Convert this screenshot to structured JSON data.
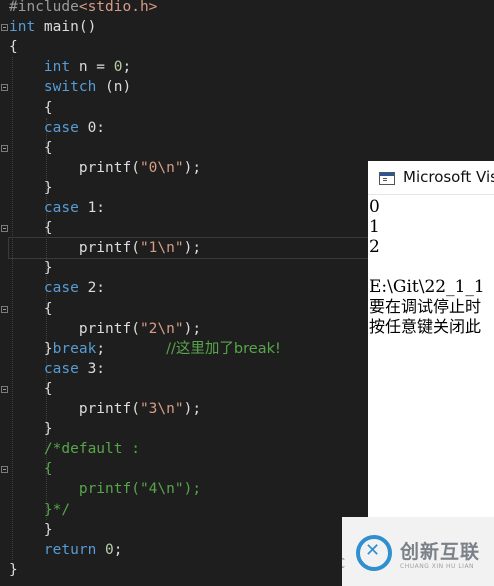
{
  "editor": {
    "lines": [
      {
        "segs": [
          {
            "t": "#include",
            "c": "pp"
          },
          {
            "t": "<stdio.h>",
            "c": "inc"
          }
        ]
      },
      {
        "segs": [
          {
            "t": "int",
            "c": "kw"
          },
          {
            "t": " main()",
            "c": "pl"
          }
        ]
      },
      {
        "segs": [
          {
            "t": "{",
            "c": "pl"
          }
        ]
      },
      {
        "segs": [
          {
            "t": "    int",
            "c": "kw"
          },
          {
            "t": " n = ",
            "c": "pl"
          },
          {
            "t": "0",
            "c": "num"
          },
          {
            "t": ";",
            "c": "pl"
          }
        ]
      },
      {
        "segs": [
          {
            "t": "    switch",
            "c": "kw"
          },
          {
            "t": " (n)",
            "c": "pl"
          }
        ]
      },
      {
        "segs": [
          {
            "t": "    {",
            "c": "pl"
          }
        ]
      },
      {
        "segs": [
          {
            "t": "    case",
            "c": "kw"
          },
          {
            "t": " 0:",
            "c": "pl"
          }
        ]
      },
      {
        "segs": [
          {
            "t": "    {",
            "c": "pl"
          }
        ]
      },
      {
        "segs": [
          {
            "t": "        printf(",
            "c": "fn"
          },
          {
            "t": "\"0\\n\"",
            "c": "str"
          },
          {
            "t": ");",
            "c": "pl"
          }
        ]
      },
      {
        "segs": [
          {
            "t": "    }",
            "c": "pl"
          }
        ]
      },
      {
        "segs": [
          {
            "t": "    case",
            "c": "kw"
          },
          {
            "t": " 1:",
            "c": "pl"
          }
        ]
      },
      {
        "segs": [
          {
            "t": "    {",
            "c": "pl"
          }
        ]
      },
      {
        "segs": [
          {
            "t": "        printf(",
            "c": "fn"
          },
          {
            "t": "\"1\\n\"",
            "c": "str"
          },
          {
            "t": ");",
            "c": "pl"
          }
        ]
      },
      {
        "segs": [
          {
            "t": "    }",
            "c": "pl"
          }
        ]
      },
      {
        "segs": [
          {
            "t": "    case",
            "c": "kw"
          },
          {
            "t": " 2:",
            "c": "pl"
          }
        ]
      },
      {
        "segs": [
          {
            "t": "    {",
            "c": "pl"
          }
        ]
      },
      {
        "segs": [
          {
            "t": "        printf(",
            "c": "fn"
          },
          {
            "t": "\"2\\n\"",
            "c": "str"
          },
          {
            "t": ");",
            "c": "pl"
          }
        ]
      },
      {
        "segs": [
          {
            "t": "    }",
            "c": "pl"
          },
          {
            "t": "break",
            "c": "kw"
          },
          {
            "t": ";       ",
            "c": "pl"
          },
          {
            "t": "//这里加了break!",
            "c": "cmt"
          }
        ]
      },
      {
        "segs": [
          {
            "t": "    case",
            "c": "kw"
          },
          {
            "t": " 3:",
            "c": "pl"
          }
        ]
      },
      {
        "segs": [
          {
            "t": "    {",
            "c": "pl"
          }
        ]
      },
      {
        "segs": [
          {
            "t": "        printf(",
            "c": "fn"
          },
          {
            "t": "\"3\\n\"",
            "c": "str"
          },
          {
            "t": ");",
            "c": "pl"
          }
        ]
      },
      {
        "segs": [
          {
            "t": "    }",
            "c": "pl"
          }
        ]
      },
      {
        "segs": [
          {
            "t": "    /*default :",
            "c": "cmt"
          }
        ]
      },
      {
        "segs": [
          {
            "t": "    {",
            "c": "cmt"
          }
        ]
      },
      {
        "segs": [
          {
            "t": "        printf(\"4\\n\");",
            "c": "cmt"
          }
        ]
      },
      {
        "segs": [
          {
            "t": "    }*/",
            "c": "cmt"
          }
        ]
      },
      {
        "segs": [
          {
            "t": "    }",
            "c": "pl"
          }
        ]
      },
      {
        "segs": [
          {
            "t": "    return",
            "c": "kw"
          },
          {
            "t": " ",
            "c": "pl"
          },
          {
            "t": "0",
            "c": "num"
          },
          {
            "t": ";",
            "c": "pl"
          }
        ]
      },
      {
        "segs": [
          {
            "t": "}",
            "c": "pl"
          }
        ]
      }
    ]
  },
  "console": {
    "title": "Microsoft Vis",
    "output": [
      "0",
      "1",
      "2",
      "",
      "E:\\Git\\22_1_1",
      "要在调试停止时",
      "按任意键关闭此"
    ]
  },
  "watermark": {
    "brand": "创新互联",
    "sub": "CHUANG XIN HU LIAN",
    "corner": "C"
  },
  "colors": {
    "background": "#1e1e1e",
    "keyword": "#569cd6",
    "string": "#d69d85",
    "comment": "#57a64a",
    "number": "#b5cea8"
  }
}
